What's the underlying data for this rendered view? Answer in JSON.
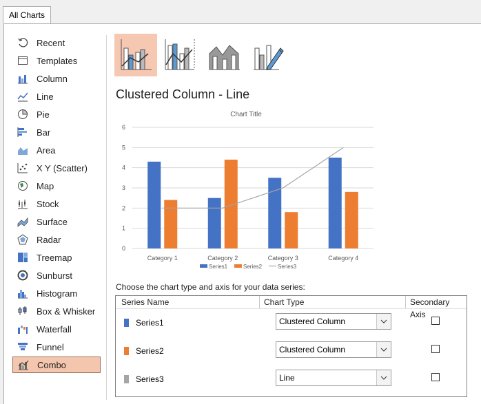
{
  "tab": {
    "label": "All Charts"
  },
  "sidebar": {
    "items": [
      {
        "label": "Recent",
        "icon": "recent-icon"
      },
      {
        "label": "Templates",
        "icon": "templates-icon"
      },
      {
        "label": "Column",
        "icon": "column-icon"
      },
      {
        "label": "Line",
        "icon": "line-icon"
      },
      {
        "label": "Pie",
        "icon": "pie-icon"
      },
      {
        "label": "Bar",
        "icon": "bar-icon"
      },
      {
        "label": "Area",
        "icon": "area-icon"
      },
      {
        "label": "X Y (Scatter)",
        "icon": "scatter-icon"
      },
      {
        "label": "Map",
        "icon": "map-icon"
      },
      {
        "label": "Stock",
        "icon": "stock-icon"
      },
      {
        "label": "Surface",
        "icon": "surface-icon"
      },
      {
        "label": "Radar",
        "icon": "radar-icon"
      },
      {
        "label": "Treemap",
        "icon": "treemap-icon"
      },
      {
        "label": "Sunburst",
        "icon": "sunburst-icon"
      },
      {
        "label": "Histogram",
        "icon": "histogram-icon"
      },
      {
        "label": "Box & Whisker",
        "icon": "box-whisker-icon"
      },
      {
        "label": "Waterfall",
        "icon": "waterfall-icon"
      },
      {
        "label": "Funnel",
        "icon": "funnel-icon"
      },
      {
        "label": "Combo",
        "icon": "combo-icon",
        "selected": true
      }
    ]
  },
  "subtypes": [
    {
      "icon": "clustered-column-line-icon",
      "selected": true
    },
    {
      "icon": "clustered-column-line-secondary-icon"
    },
    {
      "icon": "stacked-area-clustered-column-icon"
    },
    {
      "icon": "custom-combination-icon"
    }
  ],
  "section_title": "Clustered Column - Line",
  "chart_data": {
    "type": "bar",
    "title": "Chart Title",
    "categories": [
      "Category 1",
      "Category 2",
      "Category 3",
      "Category 4"
    ],
    "series": [
      {
        "name": "Series1",
        "type": "bar",
        "color": "#4472c4",
        "values": [
          4.3,
          2.5,
          3.5,
          4.5
        ]
      },
      {
        "name": "Series2",
        "type": "bar",
        "color": "#ed7d31",
        "values": [
          2.4,
          4.4,
          1.8,
          2.8
        ]
      },
      {
        "name": "Series3",
        "type": "line",
        "color": "#a5a5a5",
        "values": [
          2,
          2,
          3,
          5
        ]
      }
    ],
    "ylim": [
      0,
      6
    ],
    "yticks": [
      0,
      1,
      2,
      3,
      4,
      5,
      6
    ],
    "grid": true,
    "legend": "bottom"
  },
  "instruction": "Choose the chart type and axis for your data series:",
  "grid_headers": {
    "name": "Series Name",
    "type": "Chart Type",
    "axis": "Secondary Axis"
  },
  "series_rows": [
    {
      "name": "Series1",
      "chart_type": "Clustered Column",
      "color": "#4472c4",
      "secondary": false
    },
    {
      "name": "Series2",
      "chart_type": "Clustered Column",
      "color": "#ed7d31",
      "secondary": false
    },
    {
      "name": "Series3",
      "chart_type": "Line",
      "color": "#a5a5a5",
      "secondary": false
    }
  ]
}
